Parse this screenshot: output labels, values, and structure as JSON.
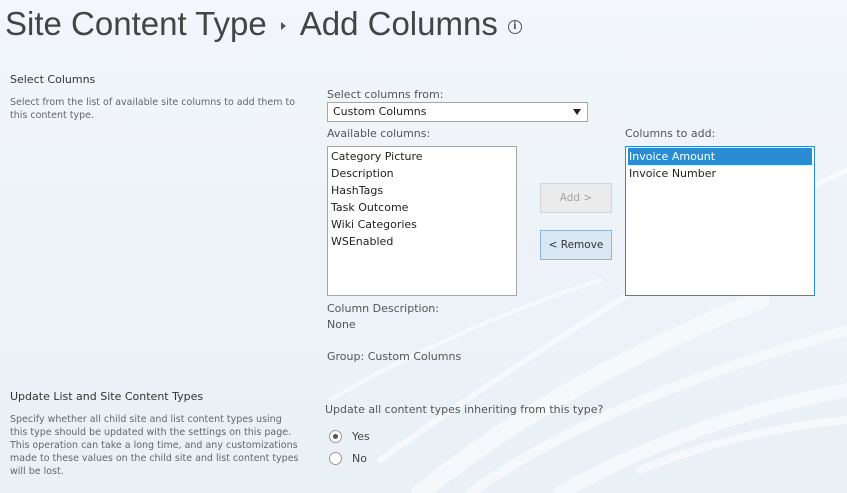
{
  "page": {
    "title_part1": "Site Content Type",
    "title_part2": "Add Columns"
  },
  "select_columns": {
    "title": "Select Columns",
    "description": "Select from the list of available site columns to add them to this content type.",
    "select_from_label": "Select columns from:",
    "select_from_value": "Custom Columns",
    "available_label": "Available columns:",
    "available_items": [
      "Category Picture",
      "Description",
      "HashTags",
      "Task Outcome",
      "Wiki Categories",
      "WSEnabled"
    ],
    "to_add_label": "Columns to add:",
    "to_add_items": [
      "Invoice Amount",
      "Invoice Number"
    ],
    "add_button": "Add >",
    "remove_button": "< Remove",
    "column_description_label": "Column Description:",
    "column_description_value": "None",
    "group_text": "Group: Custom Columns"
  },
  "update_types": {
    "title": "Update List and Site Content Types",
    "description": "Specify whether all child site and list content types using this type should be updated with the settings on this page. This operation can take a long time, and any customizations made to these values on the child site and list content types will be lost.",
    "question": "Update all content types inheriting from this type?",
    "yes_label": "Yes",
    "no_label": "No",
    "selected": "Yes"
  },
  "colors": {
    "accent": "#2a8dd4",
    "selected_item_bg": "#2a8dd4",
    "remove_button_bg": "#d9e7f3"
  }
}
